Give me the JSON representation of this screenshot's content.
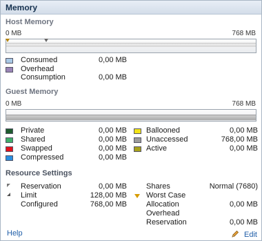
{
  "title": "Memory",
  "host_memory": {
    "heading": "Host Memory",
    "scale_min": "0 MB",
    "scale_max": "768 MB",
    "legend": [
      {
        "label": "Consumed",
        "value": "0,00 MB",
        "color": "#a9c9e6"
      },
      {
        "label": "Overhead",
        "value": "",
        "color": "#9b86b7"
      },
      {
        "label": "Consumption",
        "value": "0,00 MB",
        "color": ""
      }
    ]
  },
  "guest_memory": {
    "heading": "Guest Memory",
    "scale_min": "0 MB",
    "scale_max": "768 MB",
    "left": [
      {
        "label": "Private",
        "value": "0,00 MB",
        "color": "#1e5b2e"
      },
      {
        "label": "Shared",
        "value": "0,00 MB",
        "color": "#3fae6a"
      },
      {
        "label": "Swapped",
        "value": "0,00 MB",
        "color": "#e2111c"
      },
      {
        "label": "Compressed",
        "value": "0,00 MB",
        "color": "#2a8fe0"
      }
    ],
    "right": [
      {
        "label": "Ballooned",
        "value": "0,00 MB",
        "color": "#f2e418"
      },
      {
        "label": "Unaccessed",
        "value": "768,00 MB",
        "color": "#9c9c9c"
      },
      {
        "label": "Active",
        "value": "0,00 MB",
        "color": "#a8a21c"
      }
    ]
  },
  "resource_settings": {
    "heading": "Resource Settings",
    "reservation_label": "Reservation",
    "reservation_value": "0,00 MB",
    "limit_label": "Limit",
    "limit_value": "128,00 MB",
    "configured_label": "Configured",
    "configured_value": "768,00 MB",
    "shares_label": "Shares",
    "shares_value": "Normal (7680)",
    "worst_case_label": "Worst Case",
    "allocation_label": "Allocation",
    "allocation_value": "0,00 MB",
    "overhead_label": "Overhead",
    "overhead_reservation_label": "Reservation",
    "overhead_reservation_value": "0,00 MB"
  },
  "footer": {
    "help": "Help",
    "edit": "Edit"
  },
  "icons": {
    "reservation": "reservation-marker-icon",
    "limit": "limit-marker-icon",
    "worst_case": "worst-case-triangle-icon",
    "edit": "pencil-icon"
  }
}
